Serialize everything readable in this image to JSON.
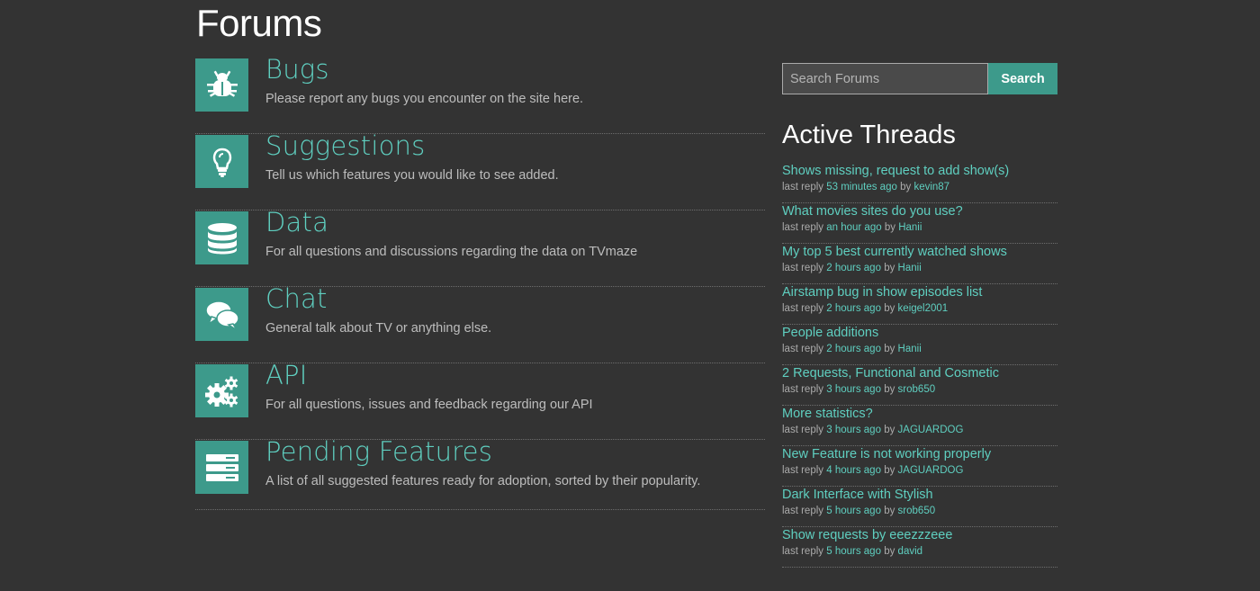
{
  "page": {
    "title": "Forums"
  },
  "forums": [
    {
      "name": "Bugs",
      "description": "Please report any bugs you encounter on the site here.",
      "icon": "bug-icon"
    },
    {
      "name": "Suggestions",
      "description": "Tell us which features you would like to see added.",
      "icon": "lightbulb-icon"
    },
    {
      "name": "Data",
      "description": "For all questions and discussions regarding the data on TVmaze",
      "icon": "database-icon"
    },
    {
      "name": "Chat",
      "description": "General talk about TV or anything else.",
      "icon": "chat-bubbles-icon"
    },
    {
      "name": "API",
      "description": "For all questions, issues and feedback regarding our API",
      "icon": "gears-icon"
    },
    {
      "name": "Pending Features",
      "description": "A list of all suggested features ready for adoption, sorted by their popularity.",
      "icon": "server-list-icon"
    }
  ],
  "search": {
    "placeholder": "Search Forums",
    "value": "",
    "button_label": "Search"
  },
  "active_threads": {
    "title": "Active Threads",
    "last_reply_label": "last reply",
    "by_label": "by",
    "items": [
      {
        "title": "Shows missing, request to add show(s)",
        "time": "53 minutes ago",
        "user": "kevin87"
      },
      {
        "title": "What movies sites do you use?",
        "time": "an hour ago",
        "user": "Hanii"
      },
      {
        "title": "My top 5 best currently watched shows",
        "time": "2 hours ago",
        "user": "Hanii"
      },
      {
        "title": "Airstamp bug in show episodes list",
        "time": "2 hours ago",
        "user": "keigel2001"
      },
      {
        "title": "People additions",
        "time": "2 hours ago",
        "user": "Hanii"
      },
      {
        "title": "2 Requests, Functional and Cosmetic",
        "time": "3 hours ago",
        "user": "srob650"
      },
      {
        "title": "More statistics?",
        "time": "3 hours ago",
        "user": "JAGUARDOG"
      },
      {
        "title": "New Feature is not working properly",
        "time": "4 hours ago",
        "user": "JAGUARDOG"
      },
      {
        "title": "Dark Interface with Stylish",
        "time": "5 hours ago",
        "user": "srob650"
      },
      {
        "title": "Show requests by eeezzzeee",
        "time": "5 hours ago",
        "user": "david"
      }
    ]
  },
  "colors": {
    "background": "#333333",
    "accent": "#3d9a8b",
    "link": "#5fcfc0"
  }
}
